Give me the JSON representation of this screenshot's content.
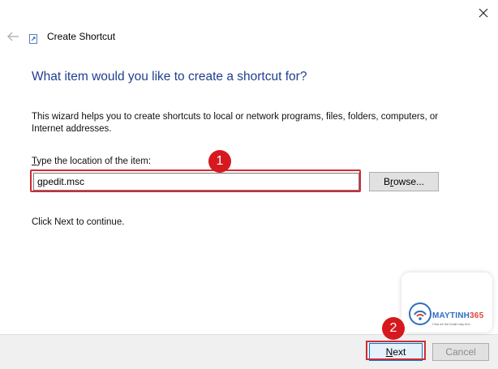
{
  "window": {
    "title": "Create Shortcut",
    "close_icon": "close-icon",
    "back_icon": "back-arrow-icon"
  },
  "main": {
    "heading": "What item would you like to create a shortcut for?",
    "description": "This wizard helps you to create shortcuts to local or network programs, files, folders, computers, or Internet addresses.",
    "field_label_mnemonic": "T",
    "field_label_rest": "ype the location of the item:",
    "location_value": "gpedit.msc",
    "browse_mnemonic": "r",
    "browse_pre": "B",
    "browse_post": "owse...",
    "continue_text": "Click Next to continue."
  },
  "annotations": {
    "step1": "1",
    "step2": "2",
    "highlight_color": "#d22b33",
    "badge_color": "#d6191e"
  },
  "footer": {
    "next_mnemonic": "N",
    "next_rest": "ext",
    "cancel_label": "Cancel"
  },
  "watermark": {
    "brand_text": "MAYTINH",
    "brand_number": "365",
    "tagline": "Chia sẻ thủ thuật máy tính"
  },
  "colors": {
    "heading": "#1f3f8f",
    "footer_bg": "#f0f0f0",
    "accent": "#0078d7"
  }
}
